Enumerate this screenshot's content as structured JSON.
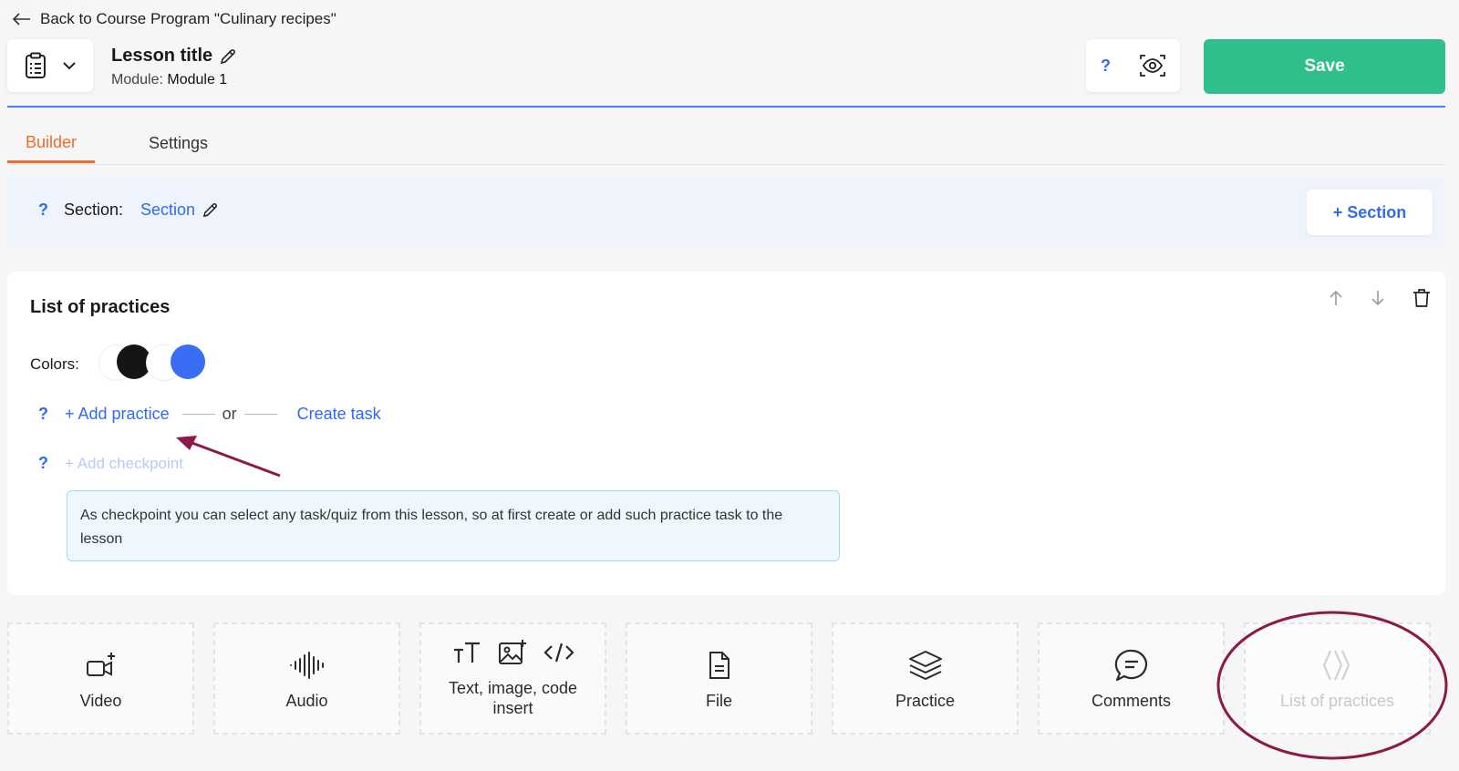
{
  "back_link": {
    "label": "Back to Course Program \"Culinary recipes\""
  },
  "header": {
    "lesson_title": "Lesson title",
    "module_label": "Module:",
    "module_name": "Module 1",
    "help": "?",
    "save_label": "Save"
  },
  "tabs": [
    {
      "label": "Builder",
      "active": true
    },
    {
      "label": "Settings",
      "active": false
    }
  ],
  "section": {
    "help": "?",
    "label": "Section:",
    "name": "Section",
    "add_label": "+ Section"
  },
  "card": {
    "title": "List of practices",
    "colors_label": "Colors:",
    "colors": [
      "#ffffff",
      "#151515",
      "#ffffff",
      "#3a6df5"
    ],
    "help": "?",
    "add_practice": "+ Add practice",
    "or": "or",
    "create_task": "Create task",
    "add_checkpoint": "+ Add checkpoint",
    "note": "As checkpoint you can select any task/quiz from this lesson, so at first create or add such practice task to the lesson"
  },
  "blocks": [
    {
      "label": "Video",
      "icon": "video-add-icon"
    },
    {
      "label": "Audio",
      "icon": "audio-wave-icon"
    },
    {
      "label": "Text, image, code insert",
      "icons": [
        "text-size-icon",
        "image-add-icon",
        "code-icon"
      ]
    },
    {
      "label": "File",
      "icon": "file-icon"
    },
    {
      "label": "Practice",
      "icon": "layers-icon"
    },
    {
      "label": "Comments",
      "icon": "comment-icon"
    },
    {
      "label": "List of practices",
      "icon": "chevrons-icon",
      "disabled": true
    }
  ],
  "colors": {
    "accent_blue": "#2f6bf0",
    "save_green": "#2fbf8a",
    "active_tab": "#f06a2c",
    "annotation": "#8b1a4a"
  }
}
